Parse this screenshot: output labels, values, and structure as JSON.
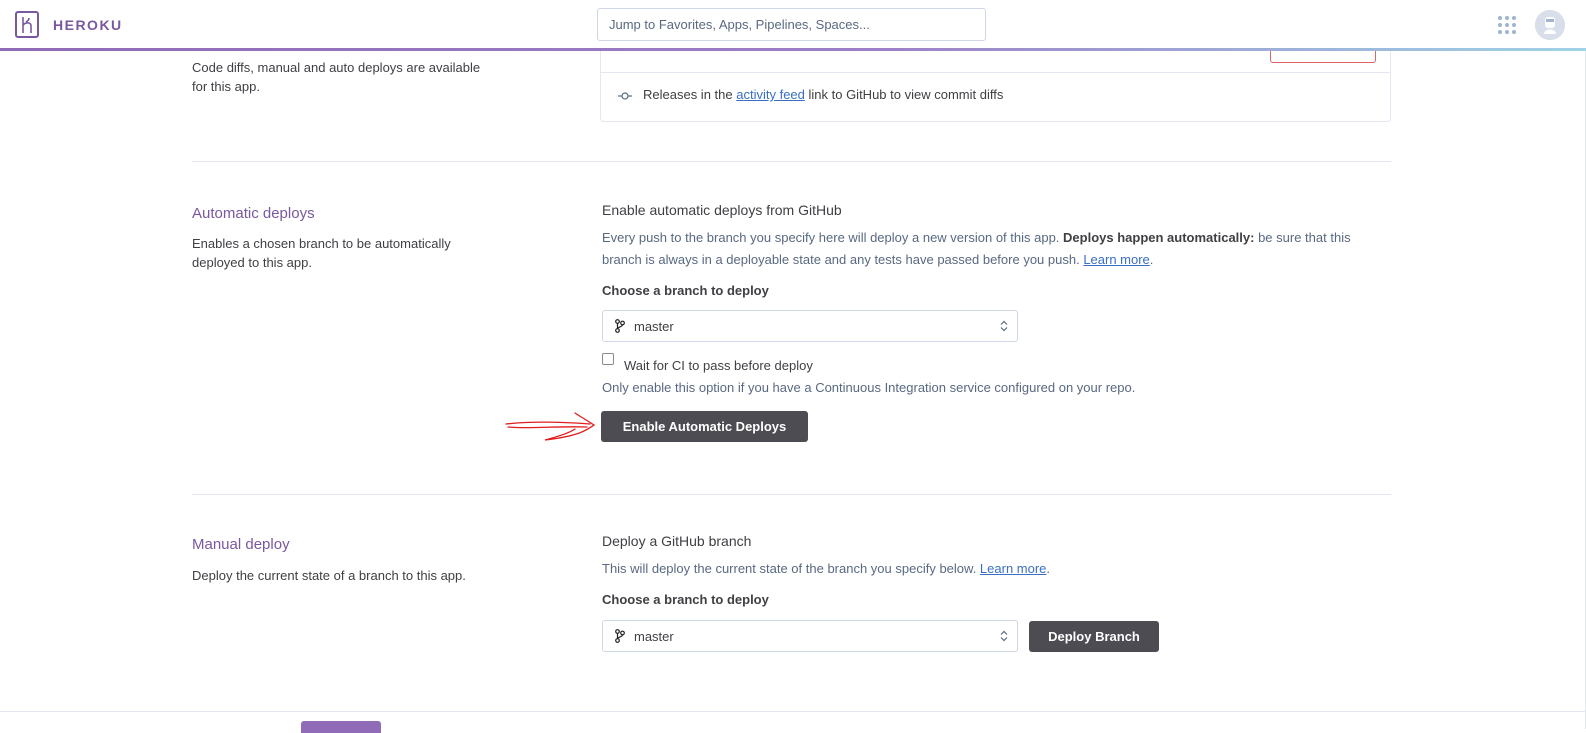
{
  "header": {
    "logo_text": "HEROKU",
    "search_placeholder": "Jump to Favorites, Apps, Pipelines, Spaces...",
    "apps_icon": "grid-dots-icon",
    "avatar_icon": "user-avatar"
  },
  "code_diffs": {
    "description": "Code diffs, manual and auto deploys are available for this app.",
    "releases_prefix": "Releases in the ",
    "releases_link": "activity feed",
    "releases_suffix": " link to GitHub to view commit diffs"
  },
  "automatic": {
    "title": "Automatic deploys",
    "description": "Enables a chosen branch to be automatically deployed to this app.",
    "heading": "Enable automatic deploys from GitHub",
    "text_prefix": "Every push to the branch you specify here will deploy a new version of this app. ",
    "text_bold": "Deploys happen automatically:",
    "text_suffix": " be sure that this branch is always in a deployable state and any tests have passed before you push. ",
    "learn_more": "Learn more",
    "choose_label": "Choose a branch to deploy",
    "branch_value": "master",
    "ci_label": "Wait for CI to pass before deploy",
    "ci_hint": "Only enable this option if you have a Continuous Integration service configured on your repo.",
    "button": "Enable Automatic Deploys"
  },
  "manual": {
    "title": "Manual deploy",
    "description": "Deploy the current state of a branch to this app.",
    "heading": "Deploy a GitHub branch",
    "text_prefix": "This will deploy the current state of the branch you specify below. ",
    "learn_more": "Learn more",
    "text_suffix": ".",
    "choose_label": "Choose a branch to deploy",
    "branch_value": "master",
    "button": "Deploy Branch"
  },
  "colors": {
    "brand": "#79589f",
    "button_dark": "#4c4c52",
    "link": "#3a6fc4",
    "annotation_arrow": "#e01e1e"
  }
}
